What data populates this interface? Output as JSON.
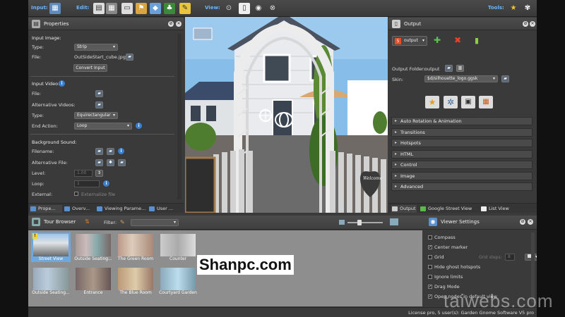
{
  "toolbar": {
    "input_label": "Input:",
    "edit_label": "Edit:",
    "view_label": "View:",
    "tools_label": "Tools:"
  },
  "properties": {
    "title": "Properties",
    "input_image_heading": "Input Image:",
    "type_label": "Type:",
    "type_value": "Strip",
    "file_label": "File:",
    "file_value": "OutSideStart_cube.jpg",
    "convert_button": "Convert Input",
    "input_video_heading": "Input Video:",
    "video_file_label": "File:",
    "alt_videos_label": "Alternative Videos:",
    "video_type_label": "Type:",
    "video_type_value": "Equirectangular",
    "end_action_label": "End Action:",
    "end_action_value": "Loop",
    "bg_sound_heading": "Background Sound:",
    "filename_label": "Filename:",
    "alt_file_label": "Alternative File:",
    "level_label": "Level:",
    "level_value": "1.00",
    "loop_label": "Loop:",
    "loop_value": "1",
    "external_label": "External:",
    "externalize_label": "Externalize file",
    "tabs": [
      "Prope...",
      "Overv...",
      "Viewing Parame...",
      "User ..."
    ]
  },
  "viewer": {
    "sign_text": "Welcome"
  },
  "output": {
    "title": "Output",
    "format_value": "output",
    "output_folder_label": "Output Folder:",
    "output_folder_value": "output",
    "skin_label": "Skin:",
    "skin_value": "$d/silhouette_logo.ggsk",
    "sections": [
      "Auto Rotation & Animation",
      "Transitions",
      "Hotspots",
      "HTML",
      "Control",
      "Image",
      "Advanced"
    ],
    "tabs": [
      "Output",
      "Google Street View",
      "List View"
    ]
  },
  "tour_browser": {
    "title": "Tour Browser",
    "filter_label": "Filter:",
    "thumbnails": [
      "Street View",
      "Outside Seating...",
      "The Green Room",
      "Counter",
      "Outside Seating...",
      "Entrance",
      "The Blue Room",
      "Courtyard Garden"
    ],
    "marker": "!"
  },
  "viewer_settings": {
    "title": "Viewer Settings",
    "options": [
      {
        "label": "Compass",
        "checked": false
      },
      {
        "label": "Center marker",
        "checked": true
      },
      {
        "label": "Grid",
        "checked": false
      },
      {
        "label": "Hide ghost hotspots",
        "checked": false
      },
      {
        "label": "Ignore limits",
        "checked": false
      },
      {
        "label": "Drag Mode",
        "checked": true
      },
      {
        "label": "Open nodes in default view",
        "checked": true
      }
    ],
    "grid_steps_label": "Grid steps:",
    "grid_steps_value": "8"
  },
  "statusbar": {
    "license": "License pro, 5 user(s): Garden Gnome Software V5 pro"
  },
  "watermarks": {
    "center": "Shanpc.com",
    "corner": "taiwebs.com"
  },
  "colors": {
    "accent": "#3a7fd0",
    "selection": "#6fa8dc",
    "panel": "#3a3a3a"
  }
}
